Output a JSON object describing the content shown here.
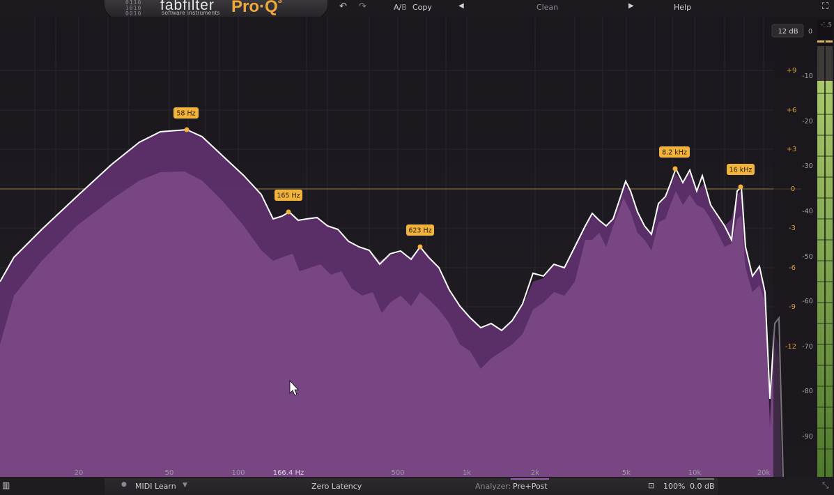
{
  "topbar": {
    "logo_grid": [
      "0110",
      "1010",
      "0010"
    ],
    "brand": "fabfilter",
    "brand_sub": "software instruments",
    "product": "Pro·Q",
    "product_version": "3",
    "undo_icon": "undo-icon",
    "redo_icon": "redo-icon",
    "ab_a": "A/",
    "ab_b": "B",
    "copy": "Copy",
    "preset": "Clean",
    "help": "Help",
    "fullscreen_icon": "fullscreen-icon"
  },
  "graph": {
    "range_label": "12 dB",
    "meter_top_label": "0",
    "meter_peak_label": "-1.5",
    "eq_db_labels": [
      "+9",
      "+6",
      "+3",
      "0",
      "-3",
      "-6",
      "-9",
      "-12"
    ],
    "analyzer_db_labels": [
      "-10",
      "-20",
      "-30",
      "-40",
      "-50",
      "-60",
      "-70",
      "-80",
      "-90"
    ],
    "freq_labels": [
      "20",
      "50",
      "100",
      "166.4 Hz",
      "500",
      "1k",
      "2k",
      "5k",
      "10k",
      "20k"
    ],
    "band_labels": [
      "58 Hz",
      "165 Hz",
      "623 Hz",
      "8.2 kHz",
      "16 kHz"
    ],
    "colors": {
      "curve": "#ffffff",
      "pre_spectrum": "#6c3a78",
      "post_spectrum": "#8d5a96",
      "band": "#f2b33c",
      "zero_line": "#9c8a4a",
      "meter": "#7fae4a"
    }
  },
  "bottombar": {
    "piano_icon": "piano-icon",
    "midi_dot_icon": "dot-icon",
    "midi_learn": "MIDI Learn",
    "midi_dropdown_icon": "dropdown-icon",
    "latency": "Zero Latency",
    "analyzer_label": "Analyzer:",
    "analyzer_value": "Pre+Post",
    "pin_icon": "pin-icon",
    "zoom": "100%",
    "gain": "0.0 dB",
    "resize_icon": "resize-icon"
  }
}
